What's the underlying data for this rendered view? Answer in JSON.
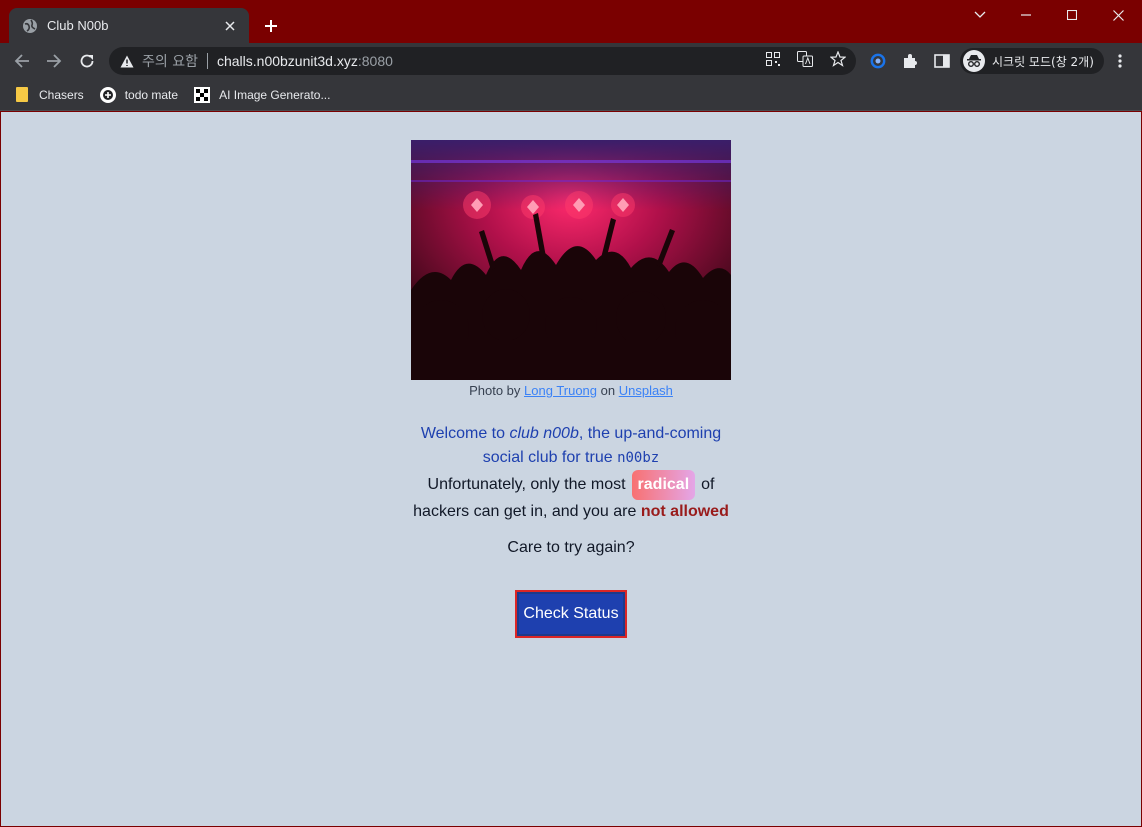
{
  "browser": {
    "tab_title": "Club N00b",
    "url_warning": "주의 요함",
    "url_host": "challs.n00bzunit3d.xyz",
    "url_port": ":8080",
    "incognito_label": "시크릿 모드(창 2개)",
    "bookmarks": [
      {
        "label": "Chasers",
        "icon": "folder-icon"
      },
      {
        "label": "todo mate",
        "icon": "todo-mate-icon"
      },
      {
        "label": "AI Image Generato...",
        "icon": "ai-image-icon"
      }
    ]
  },
  "page": {
    "photo_alt": "Concert crowd with red stage lights",
    "credit_prefix": "Photo by ",
    "credit_author": "Long Truong",
    "credit_mid": " on ",
    "credit_site": "Unsplash",
    "welcome_1": "Welcome to ",
    "welcome_club": "club n00b",
    "welcome_2": ", the up-and-coming social club for true ",
    "welcome_code": "n00bz",
    "unfort_1": "Unfortunately, only the most",
    "radical": "radical",
    "unfort_2": "of hackers can get in, and you are ",
    "not_allowed": "not allowed",
    "care": "Care to try again?",
    "check_button": "Check Status"
  },
  "colors": {
    "frame": "#7a0000",
    "page_bg": "#cbd5e1",
    "welcome_text": "#1e40af",
    "button_bg": "#1e40af",
    "button_border": "#dc2626",
    "not_allowed": "#991b1b"
  }
}
